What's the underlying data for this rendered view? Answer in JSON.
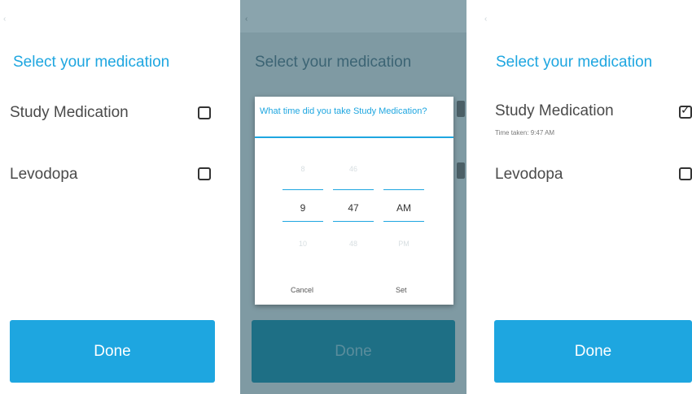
{
  "screens": {
    "left": {
      "back_glyph": "‹",
      "title": "Select your medication",
      "items": [
        {
          "label": "Study Medication",
          "checked": false
        },
        {
          "label": "Levodopa",
          "checked": false
        }
      ],
      "done_label": "Done"
    },
    "middle": {
      "back_glyph": "‹",
      "title": "Select your medication",
      "done_label": "Done",
      "dialog": {
        "title": "What time did you take Study Medication?",
        "picker": {
          "hour": {
            "prev": "8",
            "value": "9",
            "next": "10"
          },
          "minute": {
            "prev": "46",
            "value": "47",
            "next": "48"
          },
          "period": {
            "prev": "",
            "value": "AM",
            "next": "PM"
          }
        },
        "cancel_label": "Cancel",
        "set_label": "Set"
      }
    },
    "right": {
      "back_glyph": "‹",
      "title": "Select your medication",
      "items": [
        {
          "label": "Study Medication",
          "checked": true,
          "subtext": "Time taken: 9:47 AM"
        },
        {
          "label": "Levodopa",
          "checked": false
        }
      ],
      "done_label": "Done"
    }
  },
  "colors": {
    "accent": "#1ea6e0",
    "overlay": "#7f9aa3",
    "text": "#4a4a4a"
  }
}
